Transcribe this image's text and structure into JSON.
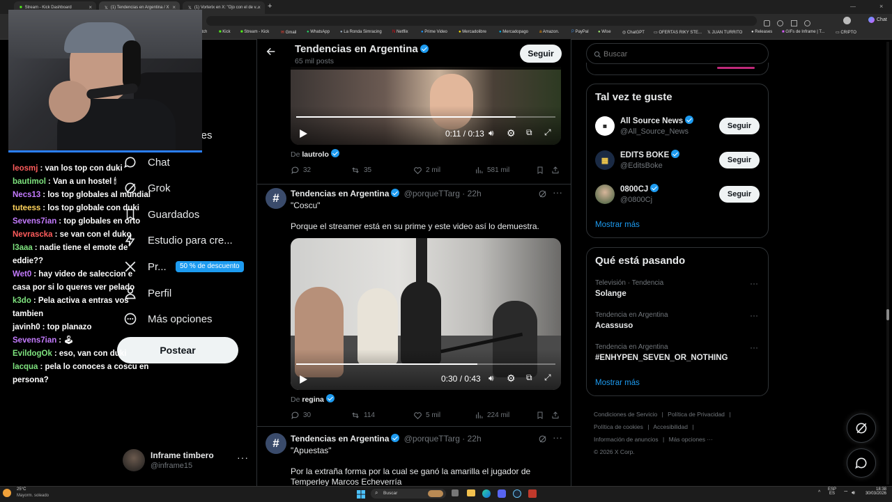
{
  "browser": {
    "tabs": [
      {
        "label": "Stream - Kick Dashboard"
      },
      {
        "label": "(1) Tendencias en Argentina / X"
      },
      {
        "label": "(1) Vorterix en X: \"Ojo con el de v..."
      }
    ],
    "right_label": "Chat",
    "bookmarks": [
      "itch",
      "Kick",
      "Stream - Kick",
      "Gmail",
      "WhatsApp",
      "La Ronda Simracing",
      "Netflix",
      "Prime Video",
      "Mercadolibre",
      "Mercadopago",
      "Amazon.",
      "PayPal",
      "Wise",
      "ChatGPT",
      "OFERTAS RIKY STE...",
      "JUAN TURRITO",
      "Releases",
      "GIFs de Inframe | T...",
      "CRIPTO"
    ]
  },
  "chat": {
    "messages": [
      {
        "user": "leosmj",
        "color": "#ff5c5c",
        "text": ": van los top con duki"
      },
      {
        "user": "bautimol",
        "color": "#7ee37e",
        "text": ": Van a un hostel 🕯"
      },
      {
        "user": "Necs13",
        "color": "#c47bff",
        "text": ": los top globales al mundial"
      },
      {
        "user": "tuteess",
        "color": "#ffd35c",
        "text": ": los top globale con duki"
      },
      {
        "user": "Sevens7ian",
        "color": "#c47bff",
        "text": ": top globales en orto"
      },
      {
        "user": "Nevrascka",
        "color": "#ff5c5c",
        "text": ": se van con el duko"
      },
      {
        "user": "l3aaa",
        "color": "#7ee37e",
        "text": ": nadie tiene el emote de eddie??"
      },
      {
        "user": "Wet0",
        "color": "#c47bff",
        "text": ": hay video de saleccion e casa por si lo queres ver pelado"
      },
      {
        "user": "k3do",
        "color": "#7ee37e",
        "text": ": Pela activa a entras vos tambien"
      },
      {
        "user": "javinh0",
        "color": "#ffffff",
        "text": ": top planazo"
      },
      {
        "user": "Sevens7ian",
        "color": "#c47bff",
        "text": ": 🕹"
      },
      {
        "user": "EvildogOk",
        "color": "#7ee37e",
        "text": ": eso, van con duki"
      },
      {
        "user": "lacqua",
        "color": "#7ee37e",
        "text": ": pela lo conoces a coscu en persona?"
      }
    ]
  },
  "nav": {
    "partial": "ones",
    "items": [
      {
        "label": "Chat"
      },
      {
        "label": "Grok"
      },
      {
        "label": "Guardados"
      },
      {
        "label": "Estudio para cre..."
      },
      {
        "label": "Pr..."
      },
      {
        "label": "Perfil"
      },
      {
        "label": "Más opciones"
      }
    ],
    "premium_badge": "50 % de descuento",
    "post_label": "Postear",
    "account": {
      "name": "Inframe timbero",
      "handle": "@inframe15"
    }
  },
  "header": {
    "title": "Tendencias en Argentina",
    "subtitle": "65 mil posts",
    "follow_label": "Seguir"
  },
  "tweets": [
    {
      "video_time": "0:11 / 0:13",
      "from_prefix": "De",
      "from_user": "lautrolo",
      "replies": "32",
      "reposts": "35",
      "likes": "2 mil",
      "views": "581 mil"
    },
    {
      "name": "Tendencias en Argentina",
      "handle": "@porqueTTarg",
      "time": "· 22h",
      "title": "\"Coscu\"",
      "text": "Porque el streamer está en su prime y este video así lo demuestra.",
      "video_time": "0:30 / 0:43",
      "from_prefix": "De",
      "from_user": "regina",
      "replies": "30",
      "reposts": "114",
      "likes": "5 mil",
      "views": "224 mil"
    },
    {
      "name": "Tendencias en Argentina",
      "handle": "@porqueTTarg",
      "time": "· 22h",
      "title": "\"Apuestas\"",
      "text": "Por la extraña forma por la cual se ganó la amarilla el jugador de Temperley Marcos Echeverría"
    }
  ],
  "search": {
    "placeholder": "Buscar"
  },
  "suggestions": {
    "title": "Tal vez te guste",
    "follow_label": "Seguir",
    "show_more": "Mostrar más",
    "accounts": [
      {
        "name": "All Source News",
        "handle": "@All_Source_News"
      },
      {
        "name": "EDITS BOKE",
        "handle": "@EditsBoke"
      },
      {
        "name": "0800CJ",
        "handle": "@0800Cj"
      }
    ]
  },
  "trends": {
    "title": "Qué está pasando",
    "show_more": "Mostrar más",
    "items": [
      {
        "meta": "Televisión · Tendencia",
        "topic": "Solange"
      },
      {
        "meta": "Tendencia en Argentina",
        "topic": "Acassuso"
      },
      {
        "meta": "Tendencia en Argentina",
        "topic": "#ENHYPEN_SEVEN_OR_NOTHING"
      }
    ]
  },
  "footer": {
    "links": [
      "Condiciones de Servicio",
      "Política de Privacidad",
      "Política de cookies",
      "Accesibilidad",
      "Información de anuncios",
      "Más opciones ···"
    ],
    "copyright": "© 2026 X Corp."
  },
  "taskbar": {
    "weather_temp": "25°C",
    "weather_text": "Mayorm. soleado",
    "search_placeholder": "Buscar",
    "lang": "ESP",
    "lang2": "ES",
    "time": "18:38",
    "date": "30/03/2026"
  },
  "colors": {
    "accent": "#1d9bf0",
    "background": "#000000",
    "border": "#2f3336"
  }
}
